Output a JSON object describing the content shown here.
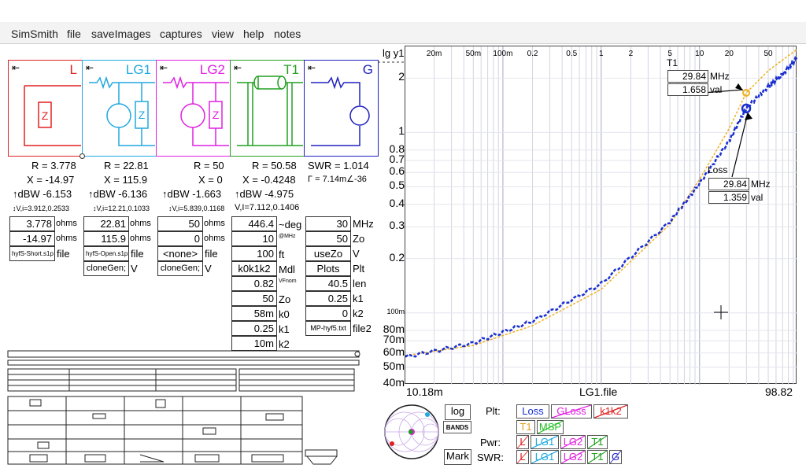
{
  "menu": [
    "SimSmith",
    "file",
    "saveImages",
    "captures",
    "view",
    "help",
    "notes"
  ],
  "panels": [
    {
      "title": "L",
      "color": "#e02020",
      "arrow": "⇤"
    },
    {
      "title": "LG1",
      "color": "#20a8e0",
      "arrow": "⇤"
    },
    {
      "title": "LG2",
      "color": "#e020e0",
      "arrow": "⇤"
    },
    {
      "title": "T1",
      "color": "#20a020",
      "arrow": "⇤"
    },
    {
      "title": "G",
      "color": "#2020c0",
      "arrow": "⇤"
    }
  ],
  "L": {
    "r": "R = 3.778",
    "x": "X = -14.97",
    "dbw": "↑dBW -6.153",
    "vi": "↕V,i=3.912,0.2533",
    "box1": "3.778",
    "unit1": "ohms",
    "box2": "-14.97",
    "unit2": "ohms",
    "file_btn": "hyfS-Short.s1p",
    "file_lbl": "file"
  },
  "LG1": {
    "r": "R = 22.81",
    "x": "X = 115.9",
    "dbw": "↑dBW -6.136",
    "vi": "↕V,i=12.21,0.1033",
    "box1": "22.81",
    "unit1": "ohms",
    "box2": "115.9",
    "unit2": "ohms",
    "file_btn": "hyfS-Open.s1p",
    "file_lbl": "file",
    "gen": "cloneGen;",
    "gen_lbl": "V"
  },
  "LG2": {
    "r": "R = 50",
    "x": "X = 0",
    "dbw": "↑dBW -1.663",
    "vi": "↕V,i=5.839,0.1168",
    "box1": "50",
    "unit1": "ohms",
    "box2": "0",
    "unit2": "ohms",
    "file_btn": "<none>",
    "file_lbl": "file",
    "gen": "cloneGen;",
    "gen_lbl": "V"
  },
  "T1": {
    "r": "R = 50.58",
    "x": "X = -0.4248",
    "dbw": "↑dBW -4.975",
    "vi": "V,I=7.112,0.1406",
    "rows": [
      {
        "val": "446.4",
        "unit": "~deg"
      },
      {
        "val": "10",
        "unit": "@MHz"
      },
      {
        "val": "100",
        "unit": "ft"
      },
      {
        "val": "k0k1k2",
        "unit": "Mdl"
      },
      {
        "val": "0.82",
        "unit": "VFnom"
      },
      {
        "val": "50",
        "unit": "Zo"
      },
      {
        "val": "58m",
        "unit": "k0"
      },
      {
        "val": "0.25",
        "unit": "k1"
      },
      {
        "val": "10m",
        "unit": "k2"
      }
    ]
  },
  "G": {
    "swr": "SWR = 1.014",
    "gamma": "Γ = 7.14m∠-36",
    "rows": [
      {
        "val": "30",
        "unit": "MHz"
      },
      {
        "val": "50",
        "unit": "Zo"
      },
      {
        "val": "useZo",
        "unit": "V"
      },
      {
        "val": "Plots",
        "unit": "Plt"
      },
      {
        "val": "40.5",
        "unit": "len"
      },
      {
        "val": "0.25",
        "unit": "k1"
      },
      {
        "val": "0",
        "unit": "k2"
      },
      {
        "val": "MP-hyf5.txt",
        "unit": "file2"
      }
    ]
  },
  "plot": {
    "ylabel": "lg y1",
    "ytick_labels": [
      "2",
      "1",
      "0.8",
      "0.7",
      "0.6",
      "0.5",
      "0.4",
      "0.3",
      "0.2",
      "100m",
      "80m",
      "70m",
      "60m",
      "50m",
      "40m"
    ],
    "xtick_labels": [
      "20m",
      "50m",
      "100m",
      "0.2",
      "0.5",
      "1",
      "2",
      "5",
      "10",
      "20",
      "50"
    ],
    "x_min_label": "10.18m",
    "x_file_label": "LG1.file",
    "x_max_label": "98.82",
    "marker_t1": {
      "label": "T1",
      "freq": "29.84",
      "freq_unit": "MHz",
      "val": "1.658",
      "val_unit": "val"
    },
    "marker_loss": {
      "label": "Loss",
      "freq": "29.84",
      "freq_unit": "MHz",
      "val": "1.359",
      "val_unit": "val"
    }
  },
  "chart_data": {
    "type": "line",
    "x_scale": "log",
    "y_scale": "log",
    "ylabel": "lg y1",
    "xlim": [
      0.01018,
      98.82
    ],
    "ylim": [
      0.04,
      3
    ],
    "series": [
      {
        "name": "T1",
        "color": "#f0b020",
        "x": [
          0.01018,
          0.05,
          0.2,
          1,
          5,
          10,
          20,
          29.84,
          50,
          98.82
        ],
        "y": [
          0.058,
          0.066,
          0.085,
          0.135,
          0.31,
          0.55,
          1.05,
          1.658,
          2.2,
          2.9
        ]
      },
      {
        "name": "Loss",
        "color": "#1a2fd0",
        "x": [
          0.01018,
          0.05,
          0.2,
          1,
          5,
          10,
          20,
          29.84,
          50,
          70,
          98.82
        ],
        "y": [
          0.057,
          0.068,
          0.09,
          0.145,
          0.32,
          0.52,
          0.9,
          1.359,
          1.8,
          2.1,
          2.6
        ]
      }
    ]
  },
  "bottom": {
    "log_btn": "log",
    "bands_btn": "BANDS",
    "mark_btn": "Mark",
    "plt_label": "Plt:",
    "pwr_label": "Pwr:",
    "swr_label": "SWR:",
    "plt_buttons": [
      {
        "label": "Loss",
        "color": "#1a2fd0"
      },
      {
        "label": "GLoss",
        "color": "#e020e0"
      },
      {
        "label": "k1k2",
        "color": "#e02020"
      },
      {
        "label": "T1",
        "color": "#e0a020"
      },
      {
        "label": "MSP",
        "color": "#20c020"
      }
    ],
    "pwr_buttons": [
      {
        "label": "L",
        "color": "#e02020"
      },
      {
        "label": "LG1",
        "color": "#20a8e0"
      },
      {
        "label": "LG2",
        "color": "#e020e0"
      },
      {
        "label": "T1",
        "color": "#20a020"
      }
    ],
    "swr_buttons": [
      {
        "label": "L",
        "color": "#e02020"
      },
      {
        "label": "LG1",
        "color": "#20a8e0"
      },
      {
        "label": "LG2",
        "color": "#e020e0"
      },
      {
        "label": "T1",
        "color": "#20a020"
      },
      {
        "label": "G",
        "color": "#2020c0"
      }
    ]
  }
}
